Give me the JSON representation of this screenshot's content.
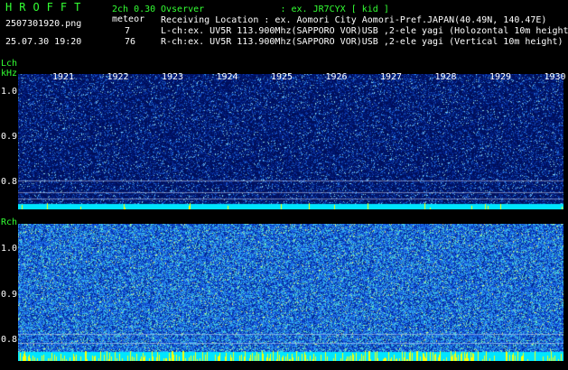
{
  "header": {
    "brand": "HROFFT",
    "version": "2ch 0.30",
    "filename": "2507301920.png",
    "datetime": "25.07.30 19:20",
    "meteor_label": "meteor",
    "meteor_l": "7",
    "meteor_r": "76",
    "observer": "Ovserver              : ex. JR7CYX [ kid ]",
    "location": "Receiving Location : ex. Aomori City Aomori-Pref.JAPAN(40.49N, 140.47E)",
    "lch": "L-ch:ex. UV5R 113.900Mhz(SAPPORO VOR)USB ,2-ele yagi (Holozontal 10m height",
    "rch": "R-ch:ex. UV5R 113.900Mhz(SAPPORO VOR)USB ,2-ele yagi (Vertical 10m height)"
  },
  "lch_panel": {
    "title": "Lch",
    "unit": "kHz",
    "ticks": [
      "1.0",
      "0.9",
      "0.8"
    ]
  },
  "rch_panel": {
    "title": "Rch",
    "ticks": [
      "1.0",
      "0.9",
      "0.8"
    ]
  },
  "time_axis": [
    "1921",
    "1922",
    "1923",
    "1924",
    "1925",
    "1926",
    "1927",
    "1928",
    "1929",
    "1930"
  ],
  "colors": {
    "text_green": "#33ff33",
    "text_white": "#ffffff",
    "bg": "#000000",
    "noise_base": "#00208a",
    "baseline": "#00e5ff"
  }
}
